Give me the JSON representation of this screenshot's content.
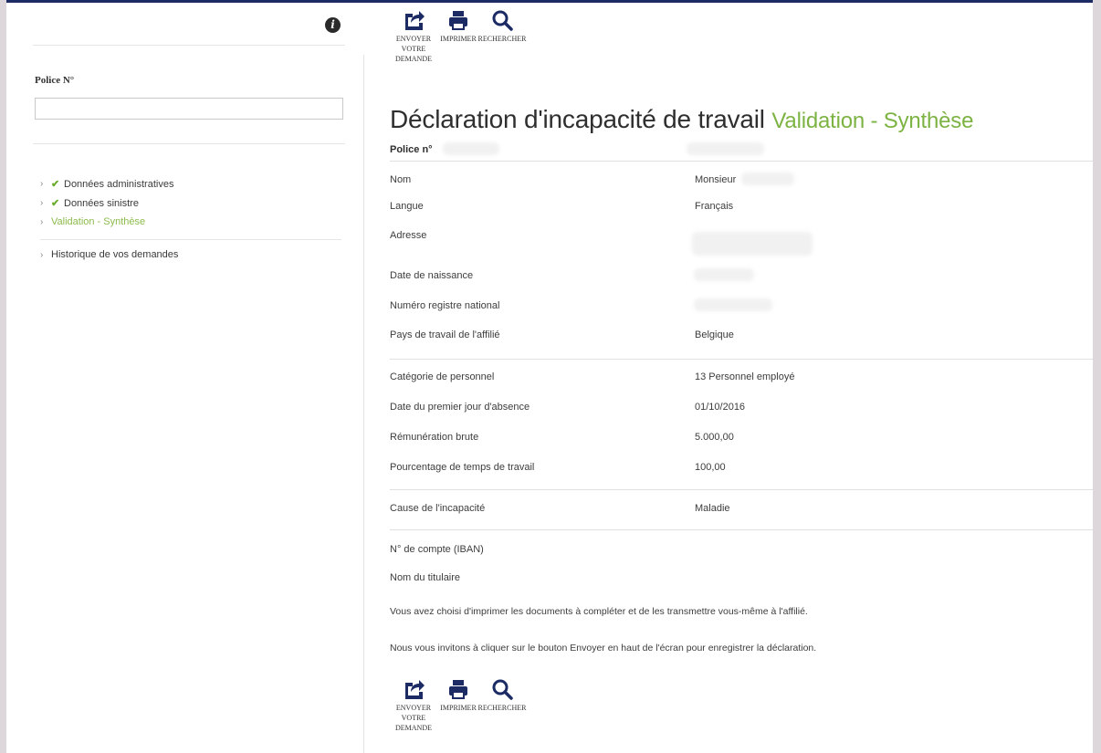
{
  "sidebar": {
    "police_label": "Police N°",
    "police_value": "",
    "nav": [
      {
        "label": "Données administratives",
        "done": true,
        "active": false
      },
      {
        "label": "Données sinistre",
        "done": true,
        "active": false
      },
      {
        "label": "Validation - Synthèse",
        "done": false,
        "active": true
      },
      {
        "label": "Historique de vos demandes",
        "done": false,
        "active": false
      }
    ]
  },
  "toolbar": {
    "send_label": "ENVOYER VOTRE DEMANDE",
    "print_label": "IMPRIMER",
    "search_label": "RECHERCHER"
  },
  "page": {
    "title": "Déclaration d'incapacité de travail",
    "subtitle": "Validation - Synthèse"
  },
  "summary": {
    "police_label": "Police n°",
    "nom_label": "Nom",
    "nom_value": "Monsieur",
    "langue_label": "Langue",
    "langue_value": "Français",
    "adresse_label": "Adresse",
    "naissance_label": "Date de naissance",
    "registre_label": "Numéro registre national",
    "pays_label": "Pays de travail de l'affilié",
    "pays_value": "Belgique",
    "categorie_label": "Catégorie de personnel",
    "categorie_value": "13 Personnel employé",
    "absence_label": "Date du premier jour d'absence",
    "absence_value": "01/10/2016",
    "remuneration_label": "Rémunération brute",
    "remuneration_value": "5.000,00",
    "pourcentage_label": "Pourcentage de temps de travail",
    "pourcentage_value": "100,00",
    "cause_label": "Cause de l'incapacité",
    "cause_value": "Maladie",
    "iban_label": "N° de compte (IBAN)",
    "titulaire_label": "Nom du titulaire",
    "note1": "Vous avez choisi d'imprimer les documents à compléter et de les transmettre vous-même à l'affilié.",
    "note2": "Nous vous invitons à cliquer sur le bouton Envoyer en haut de l'écran pour enregistrer la déclaration."
  }
}
